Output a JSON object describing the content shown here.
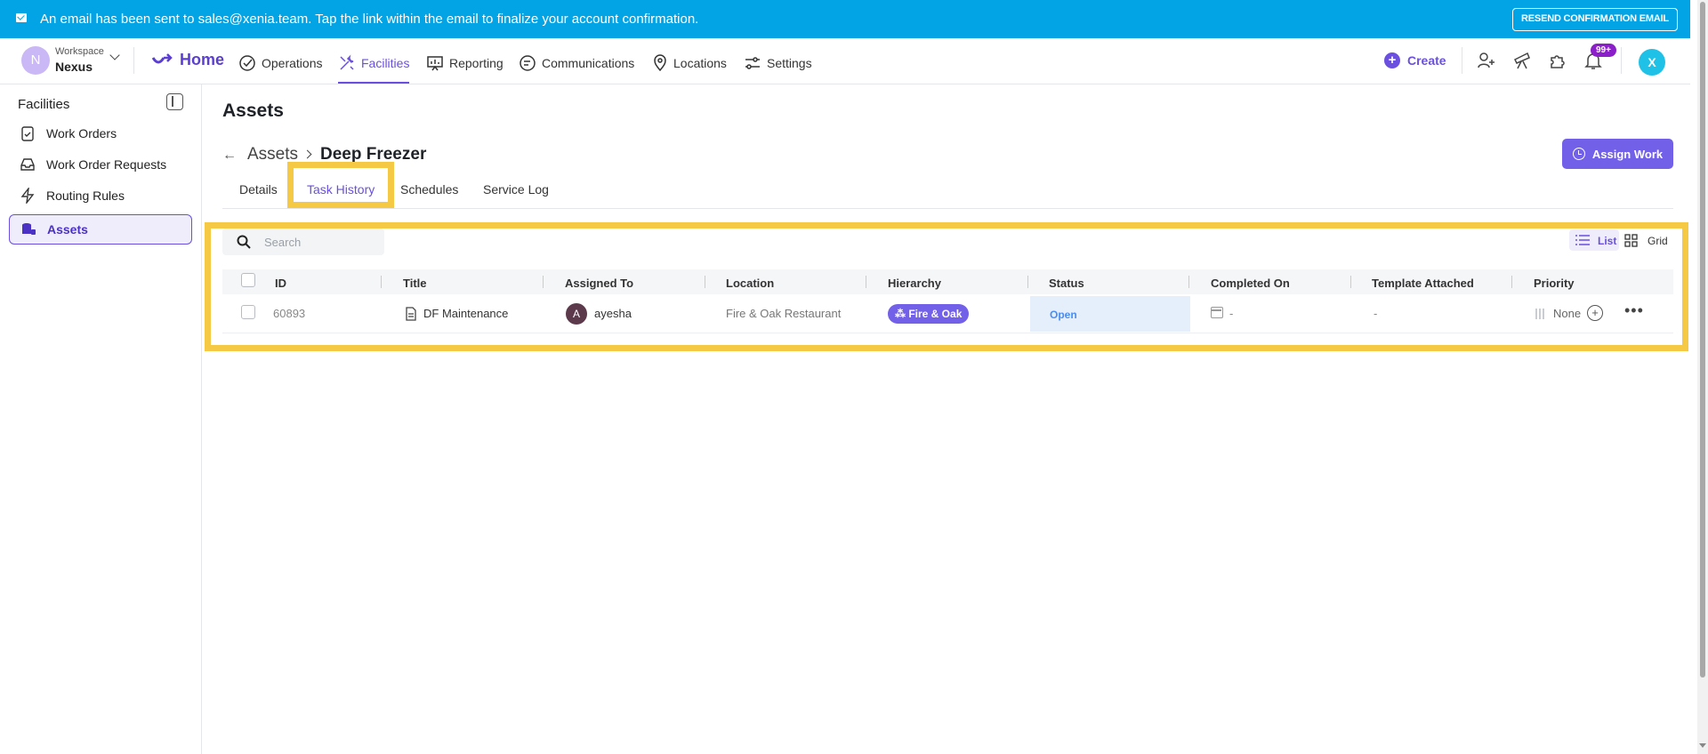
{
  "banner": {
    "message": "An email has been sent to sales@xenia.team. Tap the link within the email to finalize your account confirmation.",
    "resend_label": "RESEND CONFIRMATION EMAIL"
  },
  "workspace": {
    "avatar_letter": "N",
    "label": "Workspace",
    "name": "Nexus"
  },
  "nav": {
    "home": "Home",
    "items": [
      {
        "label": "Operations",
        "icon": "check-circle-icon"
      },
      {
        "label": "Facilities",
        "icon": "tools-icon",
        "active": true
      },
      {
        "label": "Reporting",
        "icon": "presentation-chart-icon"
      },
      {
        "label": "Communications",
        "icon": "chat-bubbles-icon"
      },
      {
        "label": "Locations",
        "icon": "map-pin-icon"
      },
      {
        "label": "Settings",
        "icon": "sliders-icon"
      }
    ],
    "create_label": "Create",
    "notifications_badge": "99+",
    "user_avatar_letter": "X"
  },
  "sidebar": {
    "title": "Facilities",
    "items": [
      {
        "label": "Work Orders",
        "icon": "clipboard-icon"
      },
      {
        "label": "Work Order Requests",
        "icon": "inbox-icon"
      },
      {
        "label": "Routing Rules",
        "icon": "lightning-icon"
      },
      {
        "label": "Assets",
        "icon": "database-icon",
        "active": true
      }
    ]
  },
  "page": {
    "title": "Assets",
    "breadcrumb_parent": "Assets",
    "breadcrumb_current": "Deep Freezer",
    "assign_work_label": "Assign Work"
  },
  "tabs": [
    "Details",
    "Task History",
    "Schedules",
    "Service Log"
  ],
  "active_tab": "Task History",
  "toolbar": {
    "search_placeholder": "Search",
    "view_list_label": "List",
    "view_grid_label": "Grid"
  },
  "table": {
    "columns": [
      "ID",
      "Title",
      "Assigned To",
      "Location",
      "Hierarchy",
      "Status",
      "Completed On",
      "Template Attached",
      "Priority"
    ],
    "rows": [
      {
        "id": "60893",
        "title": "DF Maintenance",
        "assignee_initial": "A",
        "assignee": "ayesha",
        "location": "Fire & Oak Restaurant",
        "hierarchy": "Fire & Oak",
        "status": "Open",
        "completed_on": "-",
        "template_attached": "-",
        "priority": "None"
      }
    ]
  },
  "colors": {
    "banner": "#03a4e6",
    "accent": "#6a4fe0",
    "highlight": "#f6c944",
    "status_open_bg": "#e5effc"
  }
}
